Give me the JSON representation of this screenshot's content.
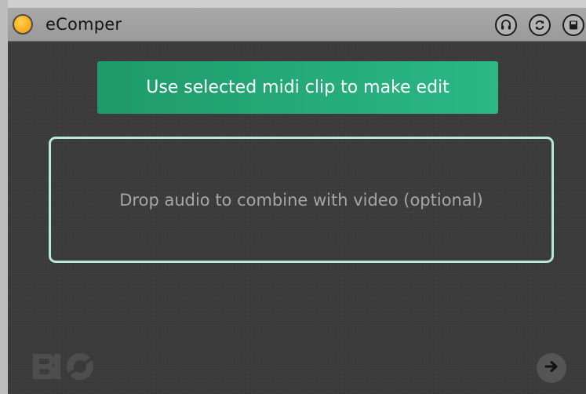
{
  "window": {
    "title": "eComper"
  },
  "titlebar_buttons": [
    {
      "icon": "headphones-icon"
    },
    {
      "icon": "refresh-icon"
    },
    {
      "icon": "save-icon"
    }
  ],
  "main": {
    "use_midi_label": "Use selected midi clip to make edit",
    "drop_zone_label": "Drop audio to combine with video (optional)"
  },
  "colors": {
    "power_led": "#f7a81b",
    "accent_button": "#2bb886",
    "drop_zone_border": "#b9e9d2",
    "panel_background": "#3a3a3a"
  },
  "icons": {
    "logo": "brand-logo-icon",
    "next": "arrow-right-icon"
  }
}
